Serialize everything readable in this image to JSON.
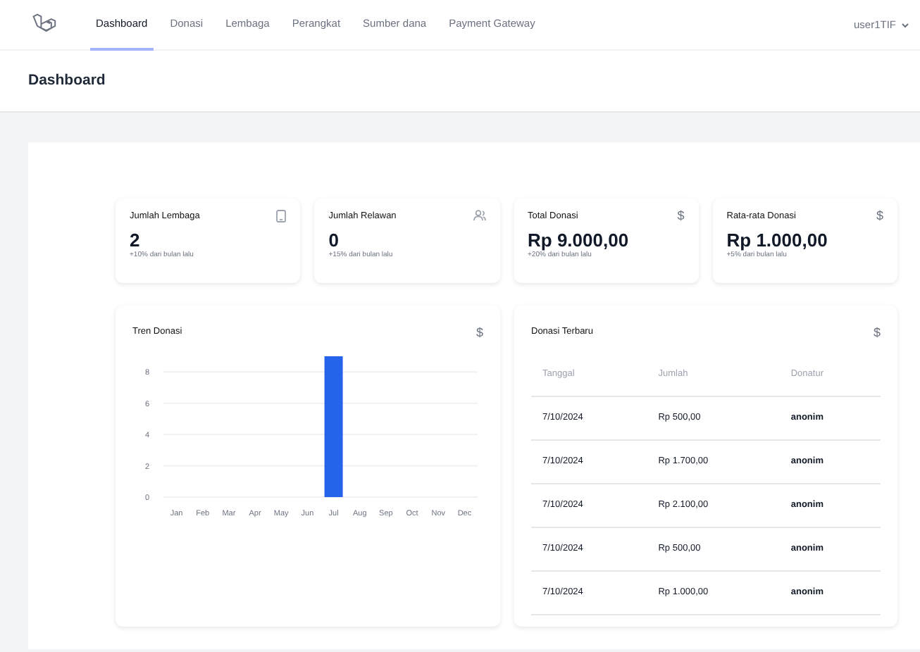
{
  "nav": {
    "tabs": [
      {
        "label": "Dashboard",
        "selected": true
      },
      {
        "label": "Donasi",
        "selected": false
      },
      {
        "label": "Lembaga",
        "selected": false
      },
      {
        "label": "Perangkat",
        "selected": false
      },
      {
        "label": "Sumber dana",
        "selected": false
      },
      {
        "label": "Payment Gateway",
        "selected": false
      }
    ],
    "user": "user1TIF"
  },
  "header": {
    "title": "Dashboard"
  },
  "stats": [
    {
      "title": "Jumlah Lembaga",
      "icon": {
        "kind": "device"
      },
      "value": "2",
      "note": "+10% dari bulan lalu"
    },
    {
      "title": "Jumlah Relawan",
      "icon": {
        "kind": "users"
      },
      "value": "0",
      "note": "+15% dari bulan lalu"
    },
    {
      "title": "Total Donasi",
      "icon": {
        "kind": "glyph",
        "text": "$"
      },
      "value": "Rp 9.000,00",
      "note": "+20% dari bulan lalu"
    },
    {
      "title": "Rata-rata Donasi",
      "icon": {
        "kind": "glyph",
        "text": "$"
      },
      "value": "Rp 1.000,00",
      "note": "+5% dari bulan lalu"
    }
  ],
  "trend": {
    "title": "Tren Donasi",
    "icon": {
      "kind": "glyph",
      "text": "$"
    },
    "chart_data": {
      "type": "bar",
      "categories": [
        "Jan",
        "Feb",
        "Mar",
        "Apr",
        "May",
        "Jun",
        "Jul",
        "Aug",
        "Sep",
        "Oct",
        "Nov",
        "Dec"
      ],
      "series": [
        {
          "color": "#2563eb",
          "values": [
            0,
            0,
            0,
            0,
            0,
            0,
            9,
            0,
            0,
            0,
            0,
            0
          ]
        }
      ],
      "grid": true,
      "ylim": [
        0,
        9
      ],
      "yticks": [
        0,
        2,
        4,
        6,
        8
      ]
    }
  },
  "recent": {
    "title": "Donasi Terbaru",
    "icon": {
      "kind": "glyph",
      "text": "$"
    },
    "columns": [
      "Tanggal",
      "Jumlah",
      "Donatur"
    ],
    "rows": [
      [
        "7/10/2024",
        "Rp 500,00",
        "anonim"
      ],
      [
        "7/10/2024",
        "Rp 1.700,00",
        "anonim"
      ],
      [
        "7/10/2024",
        "Rp 2.100,00",
        "anonim"
      ],
      [
        "7/10/2024",
        "Rp 500,00",
        "anonim"
      ],
      [
        "7/10/2024",
        "Rp 1.000,00",
        "anonim"
      ]
    ]
  }
}
